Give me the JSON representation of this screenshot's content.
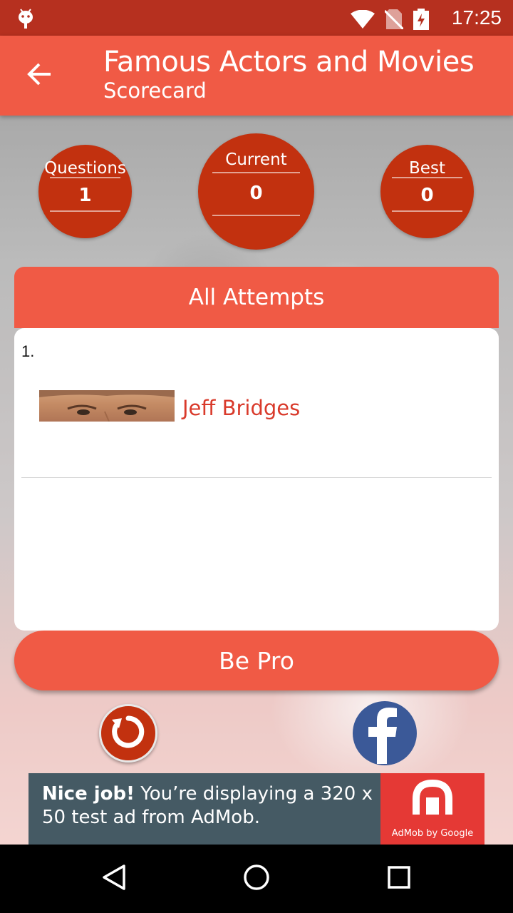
{
  "status_bar": {
    "time": "17:25"
  },
  "app_bar": {
    "title": "Famous Actors and Movies",
    "subtitle": "Scorecard"
  },
  "scores": {
    "questions": {
      "label": "Questions",
      "value": "1"
    },
    "current": {
      "label": "Current",
      "value": "0"
    },
    "best": {
      "label": "Best",
      "value": "0"
    }
  },
  "attempts": {
    "header": "All Attempts",
    "items": [
      {
        "number": "1.",
        "name": "Jeff Bridges"
      }
    ]
  },
  "be_pro_label": "Be Pro",
  "ad": {
    "headline": "Nice job!",
    "body": " You’re displaying a 320 x 50 test ad from AdMob.",
    "caption": "AdMob by Google"
  },
  "colors": {
    "status_bar": "#b6301f",
    "primary": "#f05a45",
    "circle": "#c2310f",
    "accent_text": "#d93a2b",
    "facebook": "#3b5998",
    "ad_bg": "#455a64",
    "ad_logo": "#e53935"
  },
  "icons": [
    "android-icon",
    "wifi-icon",
    "no-sim-icon",
    "battery-charging-icon",
    "back-arrow-icon",
    "restart-icon",
    "facebook-icon",
    "admob-logo-icon",
    "nav-back-icon",
    "nav-home-icon",
    "nav-recents-icon"
  ]
}
